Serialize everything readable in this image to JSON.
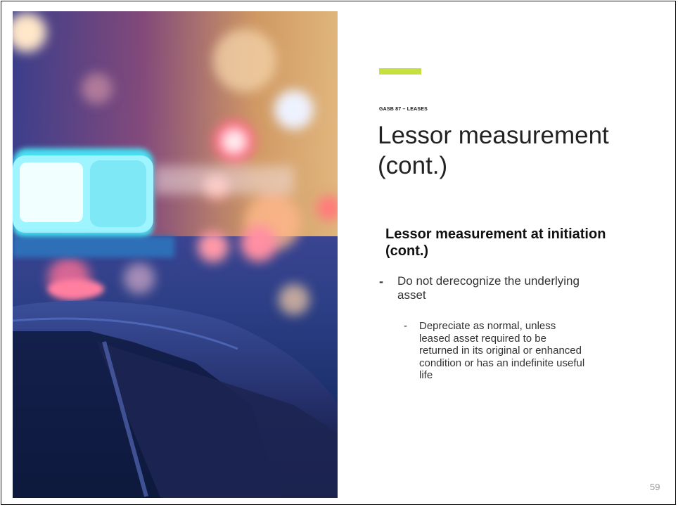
{
  "slide": {
    "eyebrow": "GASB 87 – LEASES",
    "title": "Lessor measurement (cont.)",
    "subheading": "Lessor measurement at initiation (cont.)",
    "bullets": [
      {
        "marker": "-",
        "text": "Do not derecognize the underlying asset",
        "sub_bullets": [
          {
            "marker": "-",
            "text": "Depreciate as normal, unless leased asset required to be returned in its original or enhanced condition or has an indefinite useful life"
          }
        ]
      }
    ],
    "page_number": "59",
    "accent_color": "#c5e040",
    "image": {
      "icon": "police-car-lights-photo"
    }
  }
}
